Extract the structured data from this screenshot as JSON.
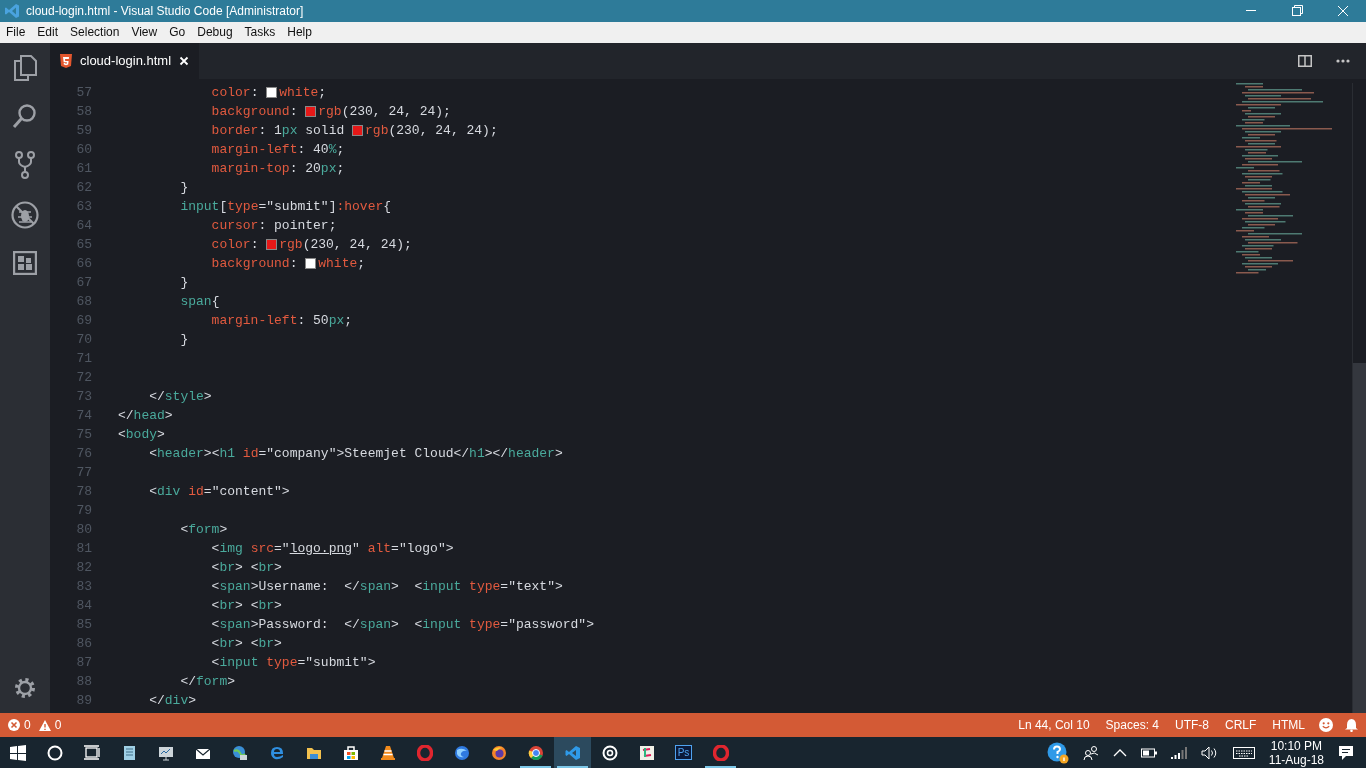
{
  "window": {
    "title": "cloud-login.html - Visual Studio Code [Administrator]"
  },
  "menu": [
    "File",
    "Edit",
    "Selection",
    "View",
    "Go",
    "Debug",
    "Tasks",
    "Help"
  ],
  "tabs": [
    {
      "label": "cloud-login.html",
      "selected": true
    }
  ],
  "code": [
    {
      "number": "57",
      "tokens": [
        {
          "t": "            color",
          "kind": "prop"
        },
        {
          "t": ": ",
          "kind": "plain"
        },
        {
          "kind": "swatch",
          "color": "#ffffff"
        },
        {
          "t": "white",
          "kind": "prop"
        },
        {
          "t": ";",
          "kind": "plain"
        }
      ]
    },
    {
      "number": "58",
      "tokens": [
        {
          "t": "            background",
          "kind": "prop"
        },
        {
          "t": ": ",
          "kind": "plain"
        },
        {
          "kind": "swatch",
          "color": "#e61818"
        },
        {
          "t": "rgb",
          "kind": "prop"
        },
        {
          "t": "(230, 24, 24);",
          "kind": "plain"
        }
      ]
    },
    {
      "number": "59",
      "tokens": [
        {
          "t": "            border",
          "kind": "prop"
        },
        {
          "t": ": 1",
          "kind": "plain"
        },
        {
          "t": "px",
          "kind": "unit"
        },
        {
          "t": " solid ",
          "kind": "plain"
        },
        {
          "kind": "swatch",
          "color": "#e61818"
        },
        {
          "t": "rgb",
          "kind": "prop"
        },
        {
          "t": "(230, 24, 24);",
          "kind": "plain"
        }
      ]
    },
    {
      "number": "60",
      "tokens": [
        {
          "t": "            margin-left",
          "kind": "prop"
        },
        {
          "t": ": 40",
          "kind": "plain"
        },
        {
          "t": "%",
          "kind": "unit"
        },
        {
          "t": ";",
          "kind": "plain"
        }
      ]
    },
    {
      "number": "61",
      "tokens": [
        {
          "t": "            margin-top",
          "kind": "prop"
        },
        {
          "t": ": 20",
          "kind": "plain"
        },
        {
          "t": "px",
          "kind": "unit"
        },
        {
          "t": ";",
          "kind": "plain"
        }
      ]
    },
    {
      "number": "62",
      "tokens": [
        {
          "t": "        }",
          "kind": "plain"
        }
      ]
    },
    {
      "number": "63",
      "tokens": [
        {
          "t": "        input",
          "kind": "tag"
        },
        {
          "t": "[",
          "kind": "plain"
        },
        {
          "t": "type",
          "kind": "prop"
        },
        {
          "t": "=\"submit\"]",
          "kind": "plain"
        },
        {
          "t": ":hover",
          "kind": "prop"
        },
        {
          "t": "{",
          "kind": "plain"
        }
      ]
    },
    {
      "number": "64",
      "tokens": [
        {
          "t": "            cursor",
          "kind": "prop"
        },
        {
          "t": ": pointer;",
          "kind": "plain"
        }
      ]
    },
    {
      "number": "65",
      "tokens": [
        {
          "t": "            color",
          "kind": "prop"
        },
        {
          "t": ": ",
          "kind": "plain"
        },
        {
          "kind": "swatch",
          "color": "#e61818"
        },
        {
          "t": "rgb",
          "kind": "prop"
        },
        {
          "t": "(230, 24, 24);",
          "kind": "plain"
        }
      ]
    },
    {
      "number": "66",
      "tokens": [
        {
          "t": "            background",
          "kind": "prop"
        },
        {
          "t": ": ",
          "kind": "plain"
        },
        {
          "kind": "swatch",
          "color": "#ffffff"
        },
        {
          "t": "white",
          "kind": "prop"
        },
        {
          "t": ";",
          "kind": "plain"
        }
      ]
    },
    {
      "number": "67",
      "tokens": [
        {
          "t": "        }",
          "kind": "plain"
        }
      ]
    },
    {
      "number": "68",
      "tokens": [
        {
          "t": "        span",
          "kind": "tag"
        },
        {
          "t": "{",
          "kind": "plain"
        }
      ]
    },
    {
      "number": "69",
      "tokens": [
        {
          "t": "            margin-left",
          "kind": "prop"
        },
        {
          "t": ": 50",
          "kind": "plain"
        },
        {
          "t": "px",
          "kind": "unit"
        },
        {
          "t": ";",
          "kind": "plain"
        }
      ]
    },
    {
      "number": "70",
      "tokens": [
        {
          "t": "        }",
          "kind": "plain"
        }
      ]
    },
    {
      "number": "71"
    },
    {
      "number": "72"
    },
    {
      "number": "73",
      "tokens": [
        {
          "t": "    </",
          "kind": "plain"
        },
        {
          "t": "style",
          "kind": "tag"
        },
        {
          "t": ">",
          "kind": "plain"
        }
      ]
    },
    {
      "number": "74",
      "tokens": [
        {
          "t": "</",
          "kind": "plain"
        },
        {
          "t": "head",
          "kind": "tag"
        },
        {
          "t": ">",
          "kind": "plain"
        }
      ]
    },
    {
      "number": "75",
      "tokens": [
        {
          "t": "<",
          "kind": "plain"
        },
        {
          "t": "body",
          "kind": "tag"
        },
        {
          "t": ">",
          "kind": "plain"
        }
      ]
    },
    {
      "number": "76",
      "tokens": [
        {
          "t": "    <",
          "kind": "plain"
        },
        {
          "t": "header",
          "kind": "tag"
        },
        {
          "t": "><",
          "kind": "plain"
        },
        {
          "t": "h1",
          "kind": "tag"
        },
        {
          "t": " id",
          "kind": "prop"
        },
        {
          "t": "=\"company\">Steemjet Cloud</",
          "kind": "plain"
        },
        {
          "t": "h1",
          "kind": "tag"
        },
        {
          "t": "></",
          "kind": "plain"
        },
        {
          "t": "header",
          "kind": "tag"
        },
        {
          "t": ">",
          "kind": "plain"
        }
      ]
    },
    {
      "number": "77"
    },
    {
      "number": "78",
      "tokens": [
        {
          "t": "    <",
          "kind": "plain"
        },
        {
          "t": "div",
          "kind": "tag"
        },
        {
          "t": " id",
          "kind": "prop"
        },
        {
          "t": "=\"content\">",
          "kind": "plain"
        }
      ]
    },
    {
      "number": "79"
    },
    {
      "number": "80",
      "tokens": [
        {
          "t": "        <",
          "kind": "plain"
        },
        {
          "t": "form",
          "kind": "tag"
        },
        {
          "t": ">",
          "kind": "plain"
        }
      ]
    },
    {
      "number": "81",
      "tokens": [
        {
          "t": "            <",
          "kind": "plain"
        },
        {
          "t": "img",
          "kind": "tag"
        },
        {
          "t": " src",
          "kind": "prop"
        },
        {
          "t": "=\"",
          "kind": "plain"
        },
        {
          "t": "logo.png",
          "kind": "link"
        },
        {
          "t": "\" ",
          "kind": "plain"
        },
        {
          "t": "alt",
          "kind": "prop"
        },
        {
          "t": "=\"logo\">",
          "kind": "plain"
        }
      ]
    },
    {
      "number": "82",
      "tokens": [
        {
          "t": "            <",
          "kind": "plain"
        },
        {
          "t": "br",
          "kind": "tag"
        },
        {
          "t": "> <",
          "kind": "plain"
        },
        {
          "t": "br",
          "kind": "tag"
        },
        {
          "t": ">",
          "kind": "plain"
        }
      ]
    },
    {
      "number": "83",
      "tokens": [
        {
          "t": "            <",
          "kind": "plain"
        },
        {
          "t": "span",
          "kind": "tag"
        },
        {
          "t": ">Username:  </",
          "kind": "plain"
        },
        {
          "t": "span",
          "kind": "tag"
        },
        {
          "t": ">  <",
          "kind": "plain"
        },
        {
          "t": "input",
          "kind": "tag"
        },
        {
          "t": " type",
          "kind": "prop"
        },
        {
          "t": "=\"text\">",
          "kind": "plain"
        }
      ]
    },
    {
      "number": "84",
      "tokens": [
        {
          "t": "            <",
          "kind": "plain"
        },
        {
          "t": "br",
          "kind": "tag"
        },
        {
          "t": "> <",
          "kind": "plain"
        },
        {
          "t": "br",
          "kind": "tag"
        },
        {
          "t": ">",
          "kind": "plain"
        }
      ]
    },
    {
      "number": "85",
      "tokens": [
        {
          "t": "            <",
          "kind": "plain"
        },
        {
          "t": "span",
          "kind": "tag"
        },
        {
          "t": ">Password:  </",
          "kind": "plain"
        },
        {
          "t": "span",
          "kind": "tag"
        },
        {
          "t": ">  <",
          "kind": "plain"
        },
        {
          "t": "input",
          "kind": "tag"
        },
        {
          "t": " type",
          "kind": "prop"
        },
        {
          "t": "=\"password\">",
          "kind": "plain"
        }
      ]
    },
    {
      "number": "86",
      "tokens": [
        {
          "t": "            <",
          "kind": "plain"
        },
        {
          "t": "br",
          "kind": "tag"
        },
        {
          "t": "> <",
          "kind": "plain"
        },
        {
          "t": "br",
          "kind": "tag"
        },
        {
          "t": ">",
          "kind": "plain"
        }
      ]
    },
    {
      "number": "87",
      "tokens": [
        {
          "t": "            <",
          "kind": "plain"
        },
        {
          "t": "input",
          "kind": "tag"
        },
        {
          "t": " type",
          "kind": "prop"
        },
        {
          "t": "=\"submit\">",
          "kind": "plain"
        }
      ]
    },
    {
      "number": "88",
      "tokens": [
        {
          "t": "        </",
          "kind": "plain"
        },
        {
          "t": "form",
          "kind": "tag"
        },
        {
          "t": ">",
          "kind": "plain"
        }
      ]
    },
    {
      "number": "89",
      "tokens": [
        {
          "t": "    </",
          "kind": "plain"
        },
        {
          "t": "div",
          "kind": "tag"
        },
        {
          "t": ">",
          "kind": "plain"
        }
      ]
    }
  ],
  "status_bar": {
    "errors": "0",
    "warnings": "0",
    "items": [
      "Ln 44, Col 10",
      "Spaces: 4",
      "UTF-8",
      "CRLF",
      "HTML"
    ]
  },
  "taskbar": {
    "apps": [
      {
        "kind": "windows",
        "running": false,
        "selected": false
      },
      {
        "kind": "circle",
        "running": false,
        "selected": false
      },
      {
        "kind": "taskview",
        "running": false,
        "selected": false
      },
      {
        "kind": "notepad",
        "running": false,
        "selected": false
      },
      {
        "kind": "monitor",
        "running": false,
        "selected": false
      },
      {
        "kind": "mail",
        "running": false,
        "selected": false
      },
      {
        "kind": "globe",
        "running": false,
        "selected": false
      },
      {
        "kind": "e",
        "running": false,
        "selected": false
      },
      {
        "kind": "folder",
        "running": false,
        "selected": false
      },
      {
        "kind": "store",
        "running": false,
        "selected": false
      },
      {
        "kind": "cone",
        "running": false,
        "selected": false
      },
      {
        "kind": "ring-red",
        "running": false,
        "selected": false
      },
      {
        "kind": "ball-blue",
        "running": false,
        "selected": false
      },
      {
        "kind": "ball-orange",
        "running": false,
        "selected": false
      },
      {
        "kind": "ball-multi",
        "running": true,
        "selected": false
      },
      {
        "kind": "ribbon",
        "running": true,
        "selected": true
      },
      {
        "kind": "target",
        "running": false,
        "selected": false
      },
      {
        "kind": "tile",
        "running": false,
        "selected": false
      },
      {
        "kind": "ps",
        "label": "Ps",
        "running": false,
        "selected": false
      },
      {
        "kind": "ring-red",
        "running": true,
        "selected": false
      }
    ],
    "time": "10:10 PM",
    "date": "11-Aug-18"
  }
}
